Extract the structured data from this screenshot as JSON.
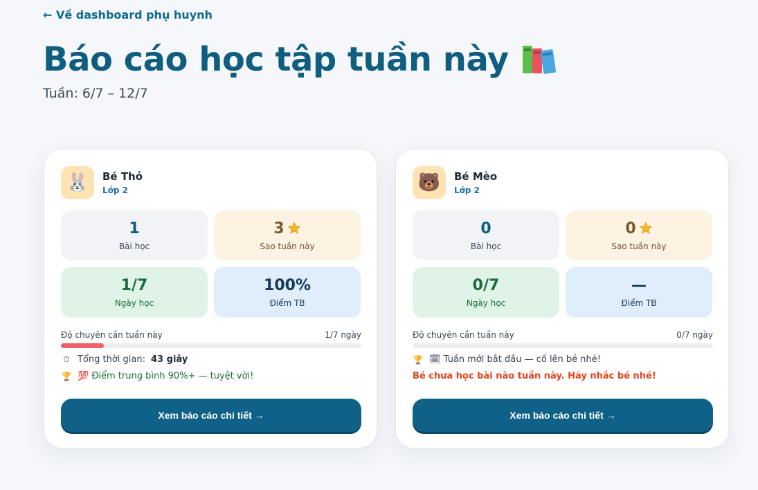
{
  "nav": {
    "back_label": "← Về dashboard phụ huynh"
  },
  "header": {
    "title": "Báo cáo học tập tuần này",
    "title_icon": "books-icon",
    "week_label": "Tuần: 6/7 – 12/7"
  },
  "children": [
    {
      "avatar_icon": "rabbit-icon",
      "avatar_glyph": "🐰",
      "name": "Bé Thỏ",
      "grade": "Lớp 2",
      "lessons_value": "1",
      "lessons_label": "Bài học",
      "stars_value": "3",
      "stars_label": "Sao tuần này",
      "days_value": "1/7",
      "days_label": "Ngày học",
      "score_value": "100%",
      "score_label": "Điểm TB",
      "progress_label": "Độ chuyên cần tuần này",
      "progress_text": "1/7 ngày",
      "progress_fraction": 0.1429,
      "time_label": "Tổng thời gian:",
      "time_value": "43 giây",
      "note": "💯 Điểm trung bình 90%+ — tuyệt vời!",
      "cta_label": "Xem báo cáo chi tiết →"
    },
    {
      "avatar_icon": "bear-icon",
      "avatar_glyph": "🐻",
      "name": "Bé Mèo",
      "grade": "Lớp 2",
      "lessons_value": "0",
      "lessons_label": "Bài học",
      "stars_value": "0",
      "stars_label": "Sao tuần này",
      "days_value": "0/7",
      "days_label": "Ngày học",
      "score_value": "—",
      "score_label": "Điểm TB",
      "progress_label": "Độ chuyên cần tuần này",
      "progress_text": "0/7 ngày",
      "progress_fraction": 0,
      "note": "🗓 Tuần mới bắt đầu — cố lên bé nhé!",
      "warning": "Bé chưa học bài nào tuần này. Hãy nhắc bé nhé!",
      "cta_label": "Xem báo cáo chi tiết →"
    }
  ],
  "colors": {
    "primary": "#0f6188",
    "title": "#0f5e80",
    "progress": "#f0606c",
    "warning": "#e0451f"
  }
}
